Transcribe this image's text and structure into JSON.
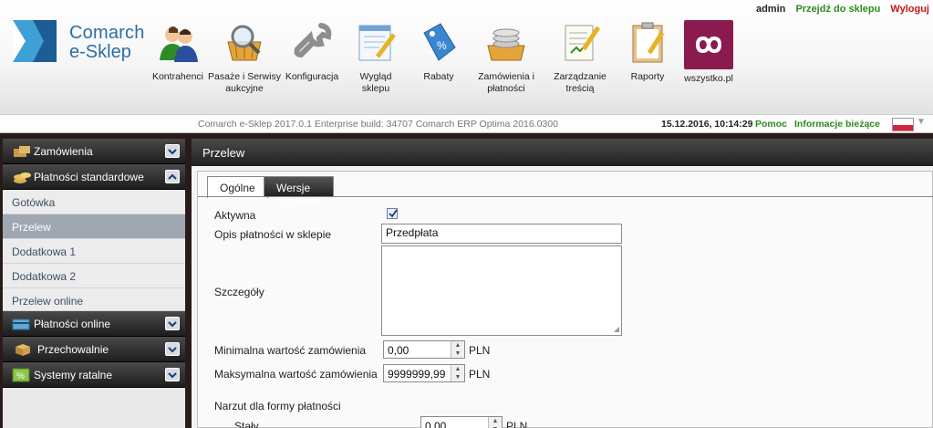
{
  "brand": {
    "name_line1": "Comarch",
    "name_line2": "e-Sklep"
  },
  "top_links": {
    "user": "admin",
    "shop": "Przejdź do sklepu",
    "logout": "Wyloguj"
  },
  "nav": [
    {
      "label": "Kontrahenci",
      "icon": "people-icon"
    },
    {
      "label": "Pasaże i Serwisy aukcyjne",
      "icon": "basket-magnifier-icon"
    },
    {
      "label": "Konfiguracja",
      "icon": "wrench-icon"
    },
    {
      "label": "Wygląd sklepu",
      "icon": "window-pencil-icon"
    },
    {
      "label": "Rabaty",
      "icon": "percent-tag-icon"
    },
    {
      "label": "Zamówienia i płatności",
      "icon": "coins-basket-icon"
    },
    {
      "label": "Zarządzanie treścią",
      "icon": "document-pencil-icon"
    },
    {
      "label": "Raporty",
      "icon": "clipboard-pencil-icon"
    },
    {
      "label": "wszystko.pl",
      "icon": "infinity-logo-icon"
    }
  ],
  "status": {
    "build": "Comarch e-Sklep 2017.0.1 Enterprise build: 34707 Comarch ERP Optima 2016.0300",
    "datetime": "15.12.2016, 10:14:29",
    "help": "Pomoc",
    "info": "Informacje bieżące"
  },
  "sidebar": {
    "sections": [
      {
        "label": "Zamówienia",
        "icon": "orders-icon",
        "expanded": false
      },
      {
        "label": "Płatności standardowe",
        "icon": "coins-icon",
        "expanded": true
      },
      {
        "label": "Płatności online",
        "icon": "card-icon",
        "expanded": false
      },
      {
        "label": "Przechowalnie",
        "icon": "box-icon",
        "expanded": false
      },
      {
        "label": "Systemy ratalne",
        "icon": "percent-icon",
        "expanded": false
      }
    ],
    "items": [
      {
        "label": "Gotówka",
        "active": false
      },
      {
        "label": "Przelew",
        "active": true
      },
      {
        "label": "Dodatkowa 1",
        "active": false
      },
      {
        "label": "Dodatkowa 2",
        "active": false
      },
      {
        "label": "Przelew online",
        "active": false
      }
    ]
  },
  "main": {
    "title": "Przelew",
    "tabs": [
      {
        "label": "Ogólne",
        "active": true
      },
      {
        "label": "Wersje językowe",
        "active": false
      }
    ],
    "form": {
      "active_label": "Aktywna",
      "active_checked": true,
      "description_label": "Opis płatności w sklepie",
      "description_value": "Przedpłata",
      "details_label": "Szczegóły",
      "details_value": "",
      "min_label": "Minimalna wartość zamówienia",
      "min_value": "0,00",
      "max_label": "Maksymalna wartość zamówienia",
      "max_value": "9999999,99",
      "currency": "PLN",
      "surcharge_label": "Narzut dla formy płatności",
      "fixed_label": "Stały",
      "fixed_value": "0,00"
    }
  },
  "colors": {
    "accent_green": "#2e8b1e",
    "logout_red": "#c0181b",
    "brand_blue": "#2a6ea8",
    "wszystko": "#8b1a4f",
    "sidebar_active": "#9fa7b3"
  }
}
